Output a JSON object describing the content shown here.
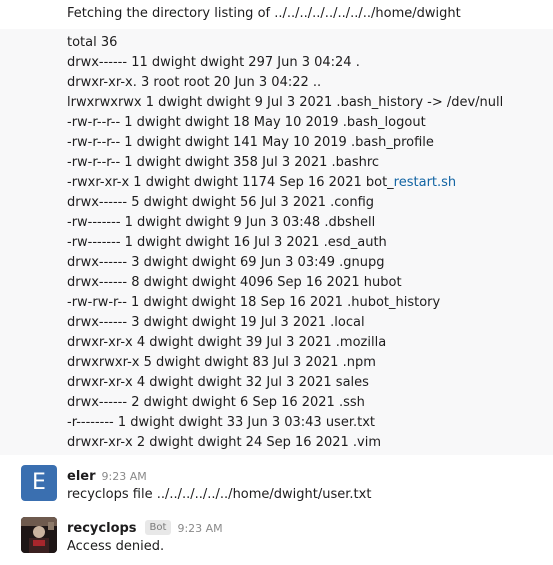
{
  "fetch_line": "Fetching the directory listing of ../../../../../../../../home/dwight",
  "listing": [
    {
      "text": "total 36"
    },
    {
      "text": "drwx------ 11 dwight dwight 297 Jun 3 04:24 ."
    },
    {
      "text": "drwxr-xr-x. 3 root root 20 Jun 3 04:22 .."
    },
    {
      "text": "lrwxrwxrwx 1 dwight dwight 9 Jul 3 2021 .bash_history -> /dev/null"
    },
    {
      "text": "-rw-r--r-- 1 dwight dwight 18 May 10 2019 .bash_logout"
    },
    {
      "text": "-rw-r--r-- 1 dwight dwight 141 May 10 2019 .bash_profile"
    },
    {
      "text": "-rw-r--r-- 1 dwight dwight 358 Jul 3 2021 .bashrc"
    },
    {
      "text": "-rwxr-xr-x 1 dwight dwight 1174 Sep 16 2021 bot_",
      "link": "restart.sh"
    },
    {
      "text": "drwx------ 5 dwight dwight 56 Jul 3 2021 .config"
    },
    {
      "text": "-rw------- 1 dwight dwight 9 Jun 3 03:48 .dbshell"
    },
    {
      "text": "-rw------- 1 dwight dwight 16 Jul 3 2021 .esd_auth"
    },
    {
      "text": "drwx------ 3 dwight dwight 69 Jun 3 03:49 .gnupg"
    },
    {
      "text": "drwx------ 8 dwight dwight 4096 Sep 16 2021 hubot"
    },
    {
      "text": "-rw-rw-r-- 1 dwight dwight 18 Sep 16 2021 .hubot_history"
    },
    {
      "text": "drwx------ 3 dwight dwight 19 Jul 3 2021 .local"
    },
    {
      "text": "drwxr-xr-x 4 dwight dwight 39 Jul 3 2021 .mozilla"
    },
    {
      "text": "drwxrwxr-x 5 dwight dwight 83 Jul 3 2021 .npm"
    },
    {
      "text": "drwxr-xr-x 4 dwight dwight 32 Jul 3 2021 sales"
    },
    {
      "text": "drwx------ 2 dwight dwight 6 Sep 16 2021 .ssh"
    },
    {
      "text": "-r-------- 1 dwight dwight 33 Jun 3 03:43 user.txt"
    },
    {
      "text": "drwxr-xr-x 2 dwight dwight 24 Sep 16 2021 .vim"
    }
  ],
  "messages": [
    {
      "avatar_letter": "E",
      "author": "eler",
      "time": "9:23 AM",
      "text": "recyclops file ../../../../../../home/dwight/user.txt"
    },
    {
      "author": "recyclops",
      "badge": "Bot",
      "time": "9:23 AM",
      "text": "Access denied."
    }
  ]
}
